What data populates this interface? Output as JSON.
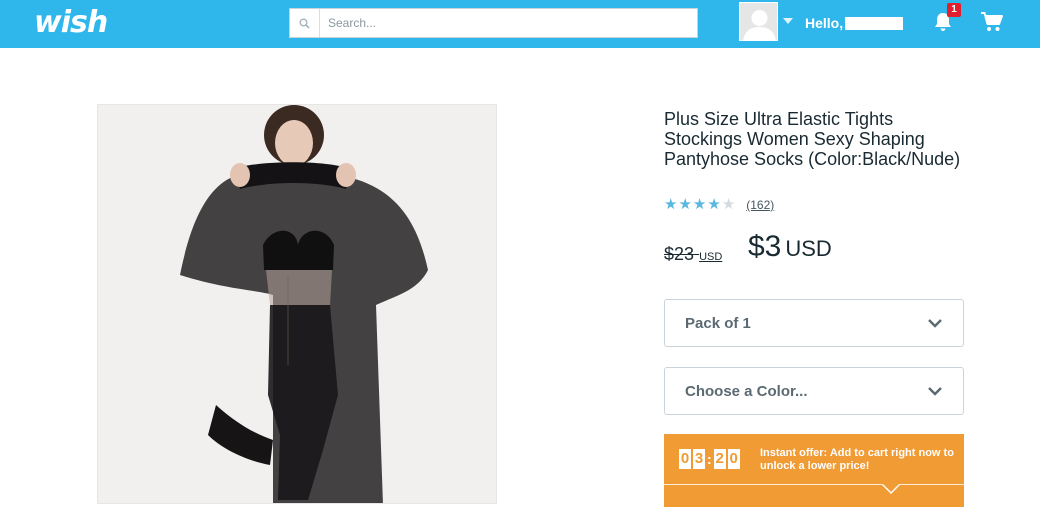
{
  "header": {
    "logo": "wish",
    "search_placeholder": "Search...",
    "greeting": "Hello,",
    "notification_count": "1",
    "bg_color": "#2fb7ec"
  },
  "product": {
    "title": "Plus Size Ultra Elastic Tights Stockings Women Sexy Shaping Pantyhose Socks (Color:Black/Nude)",
    "rating": 4,
    "rating_max": 5,
    "review_count": "(162)",
    "old_price": "$23",
    "old_price_currency": "USD",
    "price": "$3",
    "price_currency": "USD"
  },
  "options": {
    "pack_label": "Pack of 1",
    "color_label": "Choose a Color..."
  },
  "offer": {
    "timer_digits": [
      "0",
      "3",
      "2",
      "0"
    ],
    "text": "Instant offer: Add to cart right now to unlock a lower price!",
    "color": "#f19b35"
  }
}
